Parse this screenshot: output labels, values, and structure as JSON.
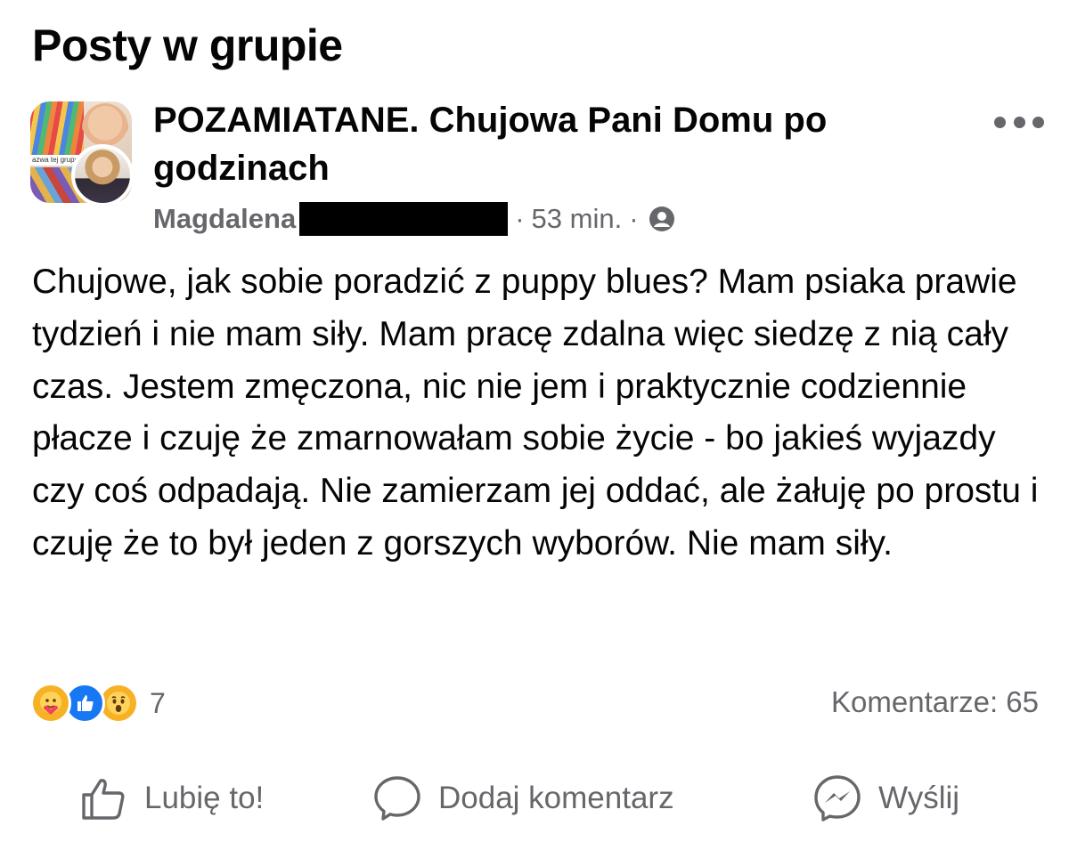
{
  "page": {
    "title": "Posty w grupie"
  },
  "post": {
    "group_name": "POZAMIATANE. Chujowa Pani Domu po godzinach",
    "group_thumb_caption": "azwa tej grupy",
    "author": "Magdalena",
    "separator": "·",
    "timestamp": "53 min.",
    "privacy_icon": "group-members-icon",
    "more_icon": "more-options-icon",
    "text": "Chujowe, jak sobie poradzić z puppy blues? Mam psiaka prawie tydzień i nie mam siły. Mam pracę zdalna więc siedzę z nią cały czas. Jestem zmęczona, nic nie jem i praktycznie codziennie płacze i czuję że zmarnowałam sobie życie - bo jakieś wyjazdy czy coś odpadają. Nie zamierzam jej oddać, ale żałuję po prostu i czuję że to był jeden z gorszych wyborów. Nie mam siły.",
    "reactions": {
      "icons": [
        "care-reaction-icon",
        "like-reaction-icon",
        "wow-reaction-icon"
      ],
      "count": "7"
    },
    "comments_label": "Komentarze: 65"
  },
  "actions": {
    "like": {
      "label": "Lubię to!",
      "icon": "thumbs-up-icon"
    },
    "comment": {
      "label": "Dodaj komentarz",
      "icon": "comment-bubble-icon"
    },
    "send": {
      "label": "Wyślij",
      "icon": "messenger-icon"
    }
  },
  "colors": {
    "text_primary": "#050505",
    "text_secondary": "#65676b",
    "like_blue": "#1877f2",
    "reaction_yellow": "#f7b125",
    "redaction": "#000000"
  }
}
